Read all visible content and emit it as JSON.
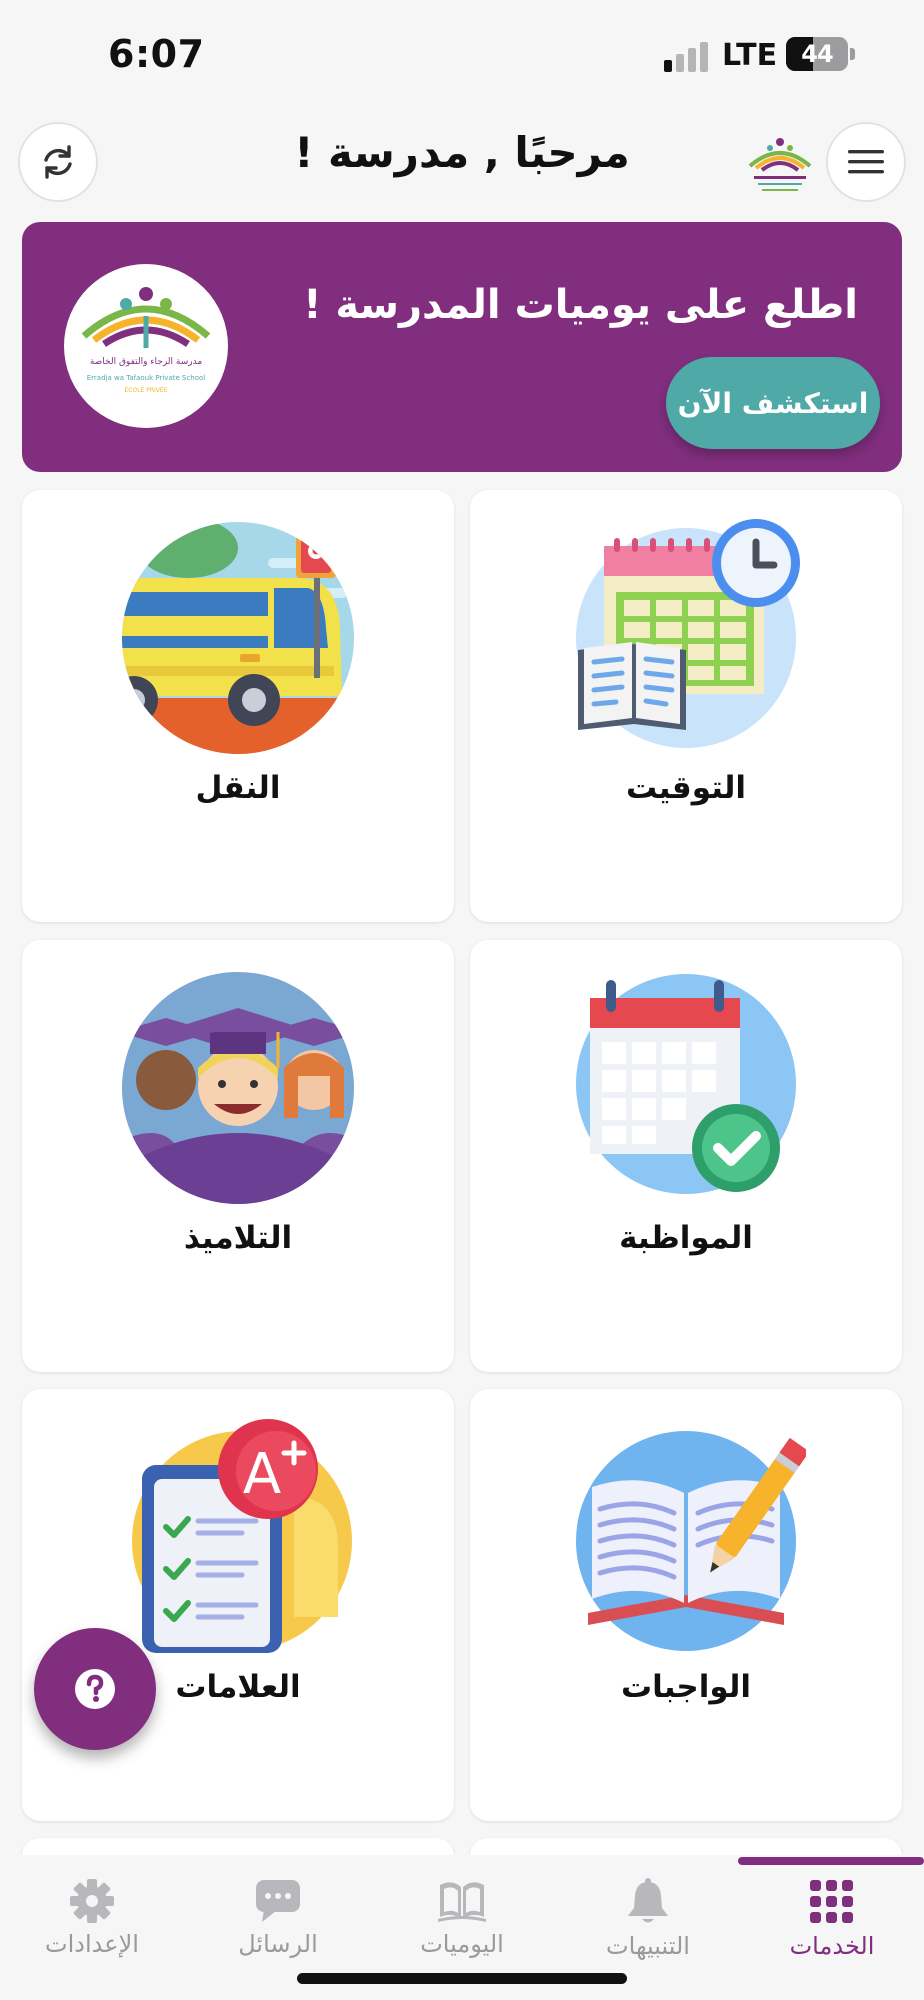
{
  "status_bar": {
    "time": "6:07",
    "network": "LTE",
    "battery": "44",
    "battery_level_percent": 44
  },
  "header": {
    "title": "مرحبًا , مدرسة !"
  },
  "banner": {
    "title": "اطلع على يوميات المدرسة !",
    "cta_label": "استكشف الآن",
    "logo_text_ar": "مدرسة الرجاء والتفوق الخاصة",
    "logo_text_en": "Erradja wa Tafaouk Private School",
    "logo_text_fr": "ÉCOLE PRIVÉE"
  },
  "services": [
    {
      "label": "التوقيت",
      "icon": "timetable-icon"
    },
    {
      "label": "النقل",
      "icon": "bus-icon"
    },
    {
      "label": "المواظبة",
      "icon": "attendance-calendar-icon"
    },
    {
      "label": "التلاميذ",
      "icon": "students-graduates-icon"
    },
    {
      "label": "الواجبات",
      "icon": "homework-book-icon"
    },
    {
      "label": "العلامات",
      "icon": "grades-icon"
    }
  ],
  "grades_badge": "A",
  "bottom_nav": {
    "items": [
      {
        "label": "الخدمات",
        "icon": "grid-icon",
        "active": true
      },
      {
        "label": "التنبيهات",
        "icon": "bell-icon",
        "active": false
      },
      {
        "label": "اليوميات",
        "icon": "open-book-icon",
        "active": false
      },
      {
        "label": "الرسائل",
        "icon": "chat-icon",
        "active": false
      },
      {
        "label": "الإعدادات",
        "icon": "gear-icon",
        "active": false
      }
    ]
  },
  "colors": {
    "brand": "#812e7e",
    "accent": "#4fa9a6",
    "background": "#f6f6f7"
  }
}
